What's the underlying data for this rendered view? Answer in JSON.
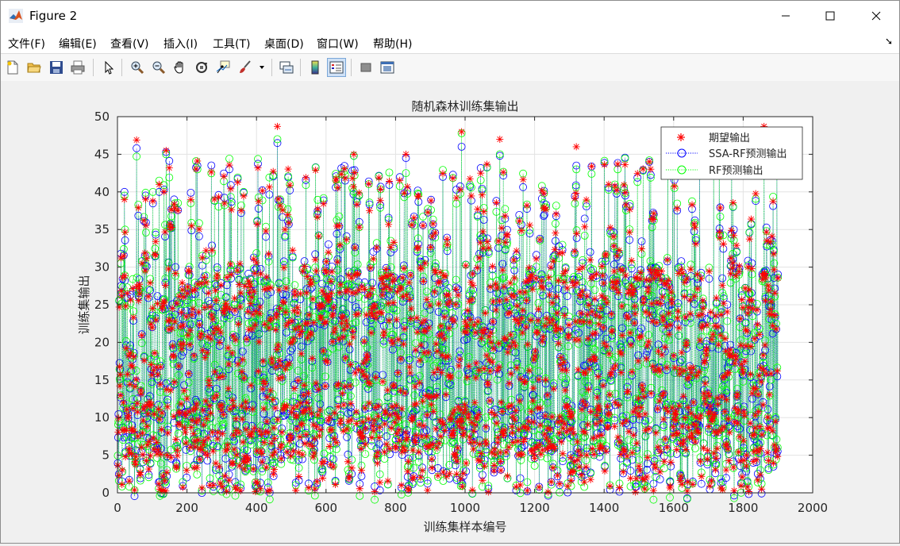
{
  "window": {
    "title": "Figure 2",
    "controls": [
      "–",
      "☐",
      "✕"
    ]
  },
  "menu": {
    "items": [
      "文件(F)",
      "编辑(E)",
      "查看(V)",
      "插入(I)",
      "工具(T)",
      "桌面(D)",
      "窗口(W)",
      "帮助(H)"
    ],
    "arrow": "➘"
  },
  "toolbar": {
    "icons": [
      "new-figure-icon",
      "open-file-icon",
      "save-icon",
      "print-icon",
      "pointer-icon",
      "zoom-in-icon",
      "zoom-out-icon",
      "pan-icon",
      "rotate-3d-icon",
      "data-cursor-icon",
      "brush-icon",
      "link-plot-icon",
      "colorbar-icon",
      "legend-icon",
      "hide-plot-tools-icon",
      "show-plot-tools-icon"
    ],
    "active": "legend-icon"
  },
  "chart_data": {
    "type": "line",
    "title": "随机森林训练集输出",
    "xlabel": "训练集样本编号",
    "ylabel": "训练集输出",
    "xlim": [
      0,
      2000
    ],
    "ylim": [
      0,
      50
    ],
    "xticks": [
      "0",
      "200",
      "400",
      "600",
      "800",
      "1000",
      "1200",
      "1400",
      "1600",
      "1800",
      "2000"
    ],
    "yticks": [
      "0",
      "5",
      "10",
      "15",
      "20",
      "25",
      "30",
      "35",
      "40",
      "45",
      "50"
    ],
    "grid": true,
    "legend_position": "top-right",
    "n_samples": 1900,
    "series": [
      {
        "name": "期望输出",
        "marker": "*",
        "color": "#ff0000",
        "line": "none"
      },
      {
        "name": "SSA-RF预测输出",
        "marker": "o",
        "color": "#0000ff",
        "line": "dotted"
      },
      {
        "name": "RF预测输出",
        "marker": "o",
        "color": "#00ff00",
        "line": "dotted"
      }
    ],
    "sample_values": {
      "x": [
        20,
        55,
        120,
        140,
        230,
        460,
        680,
        830,
        990,
        1100,
        1320,
        1530,
        1860
      ],
      "expected": [
        39,
        46.9,
        41,
        45.5,
        44.1,
        48.7,
        45,
        45,
        48,
        47,
        46,
        44,
        48.7
      ],
      "ssa_rf": [
        40,
        45.8,
        40,
        45.3,
        43.5,
        46.5,
        44.8,
        44.5,
        46,
        44.8,
        43.5,
        44,
        47.5
      ],
      "rf": [
        39.5,
        44.7,
        41.5,
        45,
        43,
        47,
        44.8,
        42.5,
        47.8,
        45,
        43,
        44.2,
        47
      ]
    }
  }
}
